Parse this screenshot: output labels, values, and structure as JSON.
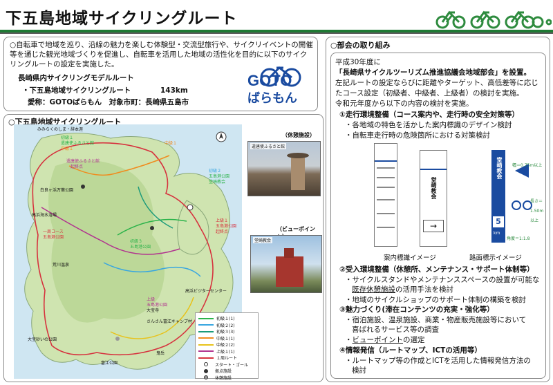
{
  "header": {
    "title": "下五島地域サイクリングルート",
    "accent": "#1f7a34"
  },
  "intro": {
    "text": "○自転車で地域を巡り、沿線の魅力を楽しむ体験型・交流型旅行や、サイクリイベントの開催等を通じた観光地域づくりを促進し、自転車を活用した地域の活性化を目的に以下のサイクリングルートの設定を実施した。",
    "model_route": "長崎県内サイクリングモデルルート",
    "route_name": "・下五島地域サイクリングルート",
    "distance": "143km",
    "alias": "愛称：GOTOばらもん　対象市町：長崎県五島市",
    "logo_top": "GOTO",
    "logo_bottom": "ばらもん"
  },
  "map": {
    "title": "○下五島地域サイクリングルート",
    "labels": [
      "みみらくのしま・辞本涯",
      "初級１",
      "遣唐使ふるさと館",
      "中級１",
      "中級１",
      "遣唐使ふるさと館",
      "起終点",
      "初級２",
      "五島港公園",
      "堂崎教会",
      "白良ヶ浜万葉公園",
      "高浜海水浴場",
      "上級１",
      "五島港公園",
      "起終点",
      "一周コース",
      "五島港公園",
      "初級３",
      "五島港公園",
      "荒川温泉",
      "高浜ビジターセンター",
      "上級",
      "五島港公園",
      "大宝寺",
      "さんさん富江キャンプ村",
      "鬼岳",
      "富江公園",
      "大宝砂いの公園"
    ],
    "legend": [
      {
        "label": "初級１(1)",
        "color": "#2bb34a"
      },
      {
        "label": "初級２(2)",
        "color": "#38a6e0"
      },
      {
        "label": "初級３(3)",
        "color": "#1a9a7a"
      },
      {
        "label": "中級１(1)",
        "color": "#f08c1e"
      },
      {
        "label": "中級２(2)",
        "color": "#e8c21a"
      },
      {
        "label": "上級１(1)",
        "color": "#b1338f"
      },
      {
        "label": "１周ルート",
        "color": "#d6323e"
      },
      {
        "label": "スタート・ゴール",
        "color": "#ffffff"
      },
      {
        "label": "拠点施設",
        "color": "#333333"
      },
      {
        "label": "休憩施設",
        "color": "#999999"
      }
    ]
  },
  "photos": {
    "rest_caption": "（休憩施設）",
    "rest_label": "遣唐使ふるさと館",
    "view_caption": "（ビューポイント）",
    "view_label": "堂崎教会"
  },
  "right": {
    "title": "○部会の取り組み",
    "lines": {
      "l1": "平成30年度に",
      "l2": "「長崎県サイクルツーリズム推進協議会地域部会」を設置。",
      "l3": "左記ルートの設定ならびに距離やターゲット、高低差等に応じ",
      "l4": "たコース設定（初級者、中級者、上級者）の検討を実施。",
      "l5": "令和元年度から以下の内容の検討を実施。"
    },
    "s1": {
      "head": "①走行環境整備（コース案内や、走行時の安全対策等）",
      "b1": "・各地域の特色を活かした案内標識のデザイン検討",
      "b2": "・自転車走行時の危険箇所における対策検討"
    },
    "sign_caption_1": "案内標識イメージ",
    "sign_caption_2": "路面標示イメージ",
    "sign_church": "堂崎教会",
    "road_width": "幅＝0.75m以上",
    "road_length": "長さ＝1.50m以上",
    "road_angle": "角度＝1:1.8",
    "road_number": "5",
    "road_unit": "km",
    "s2": {
      "head": "②受入環境整備（休憩所、メンテナンス・サポート体制等）",
      "b1": "・サイクルスタンドやメンテナンススペースの設置が可能な",
      "b1b": "既存休憩施設",
      "b1c": "の活用手法を検討",
      "b2": "・地域のサイクルショップのサポート体制の構築を検討"
    },
    "s3": {
      "head": "③魅力づくり(滞在コンテンツの充実・強化等）",
      "b1": "・宿泊施設、温泉施設、商業・物産販売施設等において",
      "b1b": "喜ばれるサービス等の調査",
      "b2": "ビューポイント",
      "b2b": "の選定"
    },
    "s4": {
      "head": "④情報発信（ルートマップ、ICTの活用等）",
      "b1": "・ルートマップ等の作成とICTを活用した情報発信方法の",
      "b1b": "検討"
    }
  }
}
